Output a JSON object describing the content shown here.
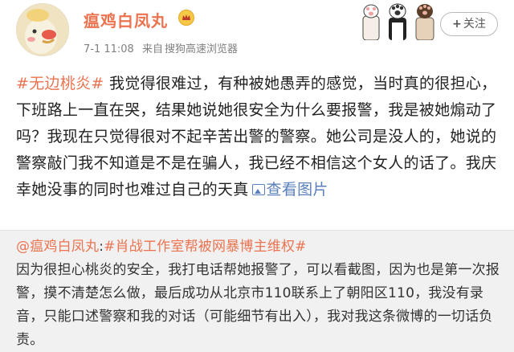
{
  "user": {
    "name": "瘟鸡白凤丸",
    "time": "7-1 11:08",
    "source_prefix": "来自",
    "source": "搜狗高速浏览器"
  },
  "follow_button": {
    "plus": "+",
    "label": "关注"
  },
  "post": {
    "hashtag": "#无边桃炎#",
    "text": "我觉得很难过，有种被她愚弄的感觉，当时真的很担心，下班路上一直在哭，结果她说她很安全为什么要报警，我是被她煽动了吗？我现在只觉得很对不起辛苦出警的警察。她公司是没人的，她说的警察敲门我不知道是不是在骗人，我已经不相信这个女人的话了。我庆幸她没事的同时也难过自己的天真",
    "view_images": "查看图片"
  },
  "repost": {
    "author": "@瘟鸡白凤丸",
    "separator": ":",
    "hashtag": "#肖战工作室帮被网暴博主维权#",
    "text": "因为很担心桃炎的安全，我打电话帮她报警了，可以看截图，因为也是第一次报警，摸不清楚怎么做，最后成功从北京市110联系上了朝阳区110，我没有录音，只能口述警察和我的对话（可能细节有出入），我对我这条微博的一切话负责。"
  },
  "icons": {
    "avatar": "cartoon-duck-avatar",
    "badge": "vip-crown-badge",
    "decoration": "cat-paws-decoration",
    "view_images": "picture-icon"
  },
  "colors": {
    "username": "#eb7350",
    "link": "#eb7350",
    "view_images": "#5a7fbf",
    "repost_bg": "#f1f1f1"
  }
}
